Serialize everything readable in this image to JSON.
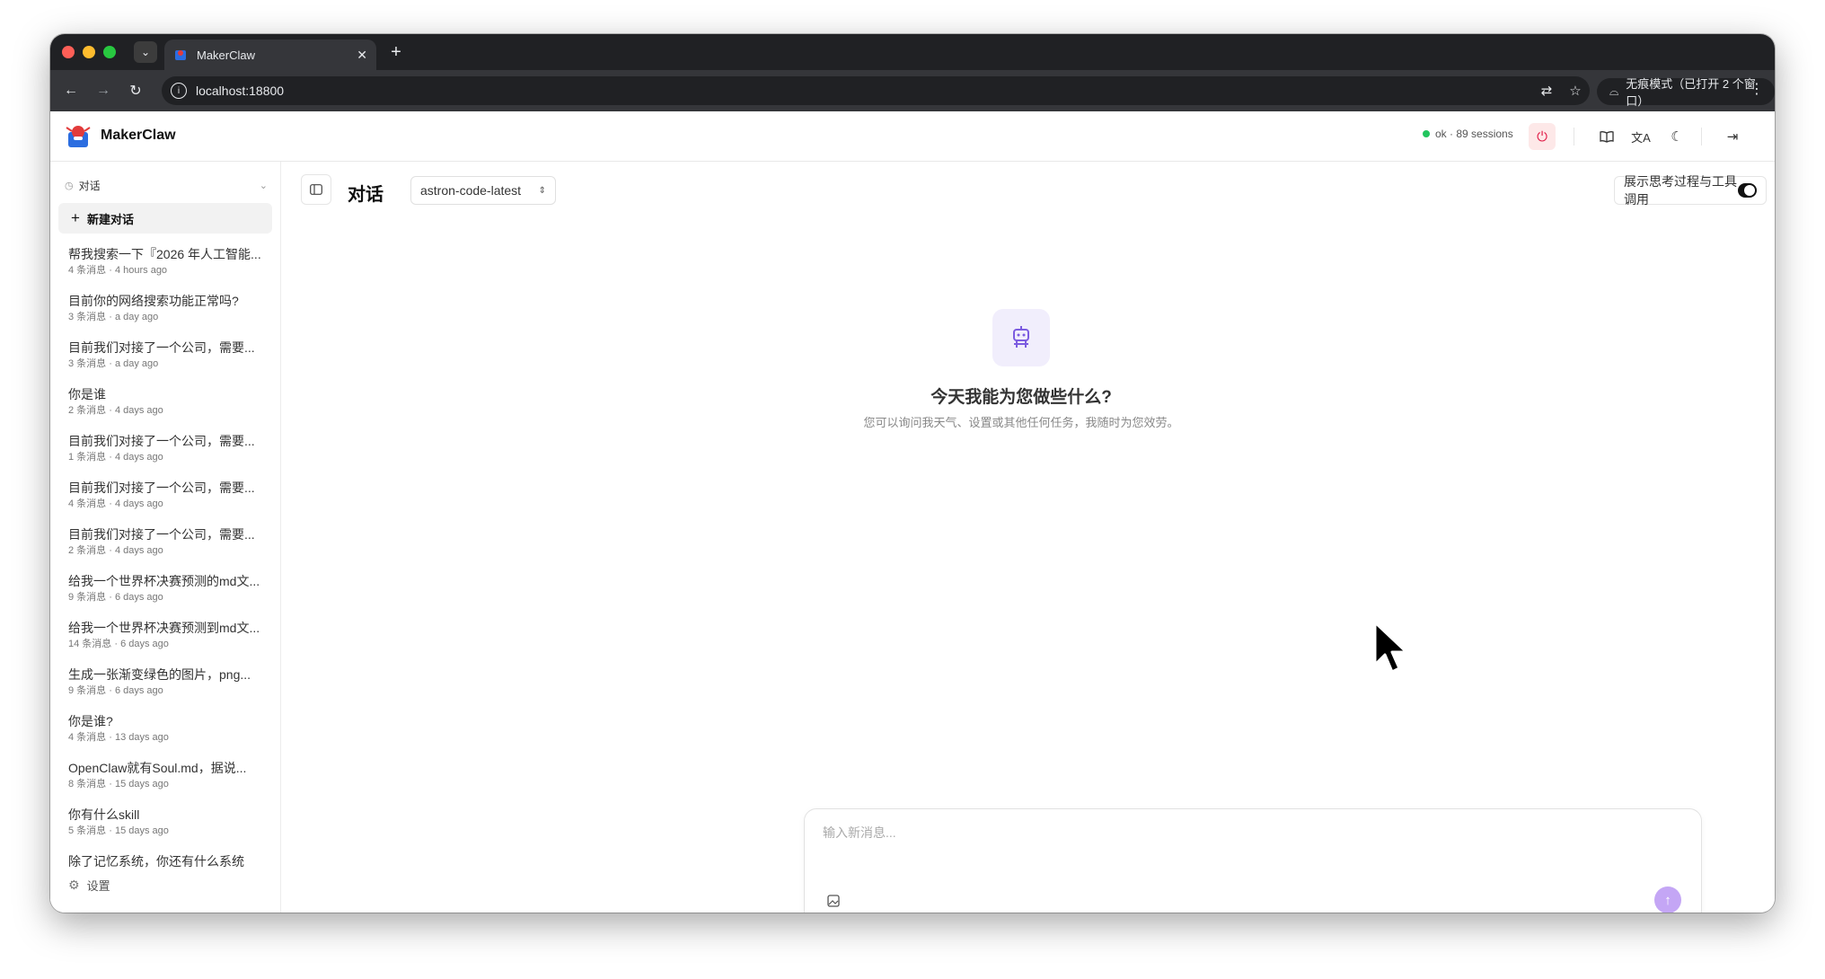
{
  "browser": {
    "tab_title": "MakerClaw",
    "tab_close": "✕",
    "new_tab": "+",
    "url": "localhost:18800",
    "incognito_label": "无痕模式（已打开 2 个窗口）"
  },
  "header": {
    "brand": "MakerClaw",
    "status_text": "ok · 89 sessions"
  },
  "sidebar": {
    "section_label": "对话",
    "new_chat_label": "新建对话",
    "conversations": [
      {
        "title": "帮我搜索一下『2026 年人工智能...",
        "meta": "4 条消息 · 4 hours ago"
      },
      {
        "title": "目前你的网络搜索功能正常吗?",
        "meta": "3 条消息 · a day ago"
      },
      {
        "title": "目前我们对接了一个公司，需要...",
        "meta": "3 条消息 · a day ago"
      },
      {
        "title": "你是谁",
        "meta": "2 条消息 · 4 days ago"
      },
      {
        "title": "目前我们对接了一个公司，需要...",
        "meta": "1 条消息 · 4 days ago"
      },
      {
        "title": "目前我们对接了一个公司，需要...",
        "meta": "4 条消息 · 4 days ago"
      },
      {
        "title": "目前我们对接了一个公司，需要...",
        "meta": "2 条消息 · 4 days ago"
      },
      {
        "title": "给我一个世界杯决赛预测的md文...",
        "meta": "9 条消息 · 6 days ago"
      },
      {
        "title": "给我一个世界杯决赛预测到md文...",
        "meta": "14 条消息 · 6 days ago"
      },
      {
        "title": "生成一张渐变绿色的图片，png...",
        "meta": "9 条消息 · 6 days ago"
      },
      {
        "title": "你是谁?",
        "meta": "4 条消息 · 13 days ago"
      },
      {
        "title": "OpenClaw就有Soul.md，据说...",
        "meta": "8 条消息 · 15 days ago"
      },
      {
        "title": "你有什么skill",
        "meta": "5 条消息 · 15 days ago"
      },
      {
        "title": "除了记忆系统，你还有什么系统",
        "meta": ""
      }
    ],
    "settings_label": "设置"
  },
  "main": {
    "title": "对话",
    "model": "astron-code-latest",
    "think_toggle_label": "展示思考过程与工具调用",
    "think_toggle_on": true,
    "hero_title": "今天我能为您做些什么?",
    "hero_subtitle": "您可以询问我天气、设置或其他任何任务，我随时为您效劳。",
    "composer_placeholder": "输入新消息..."
  },
  "colors": {
    "accent_purple": "#c4a6f5",
    "status_ok": "#22c55e",
    "power_red": "#e11d48"
  }
}
